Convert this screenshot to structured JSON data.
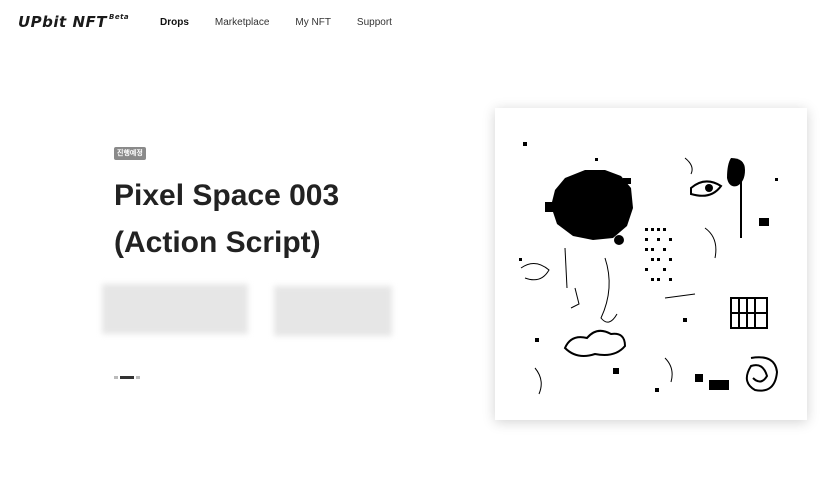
{
  "header": {
    "logo_text": "UPbit NFT",
    "logo_sup": "Beta",
    "nav": [
      {
        "label": "Drops",
        "active": true
      },
      {
        "label": "Marketplace",
        "active": false
      },
      {
        "label": "My NFT",
        "active": false
      },
      {
        "label": "Support",
        "active": false
      }
    ]
  },
  "hero": {
    "badge": "진행예정",
    "title_line1": "Pixel Space 003",
    "title_line2": "(Action Script)",
    "carousel": {
      "total": 3,
      "active_index": 1
    }
  },
  "artwork": {
    "colors": {
      "ink": "#000000",
      "paper": "#ffffff"
    }
  }
}
